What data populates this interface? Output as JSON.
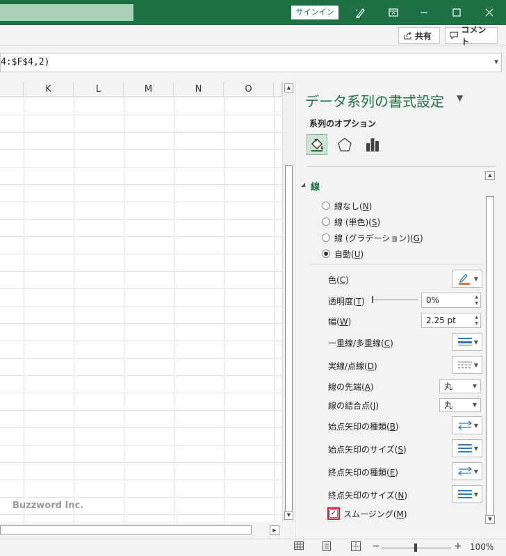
{
  "titlebar": {
    "signin_label": "サインイン",
    "icons": [
      "pen-icon",
      "ribbon-display-icon",
      "minimize-icon",
      "maximize-icon",
      "close-icon"
    ]
  },
  "ribbon": {
    "share_label": "共有",
    "comment_label": "コメント"
  },
  "formula": {
    "text": "4:$F$4,2)"
  },
  "grid": {
    "columns": [
      "K",
      "L",
      "M",
      "N",
      "O"
    ],
    "watermark": "Buzzword Inc."
  },
  "pane": {
    "title": "データ系列の書式設定",
    "series_dropdown": "系列のオプション",
    "section_title": "線",
    "line_options": [
      {
        "label": "線なし(",
        "key": "N",
        "suffix": ")",
        "selected": false
      },
      {
        "label": "線 (単色)(",
        "key": "S",
        "suffix": ")",
        "selected": false
      },
      {
        "label": "線 (グラデーション)(",
        "key": "G",
        "suffix": ")",
        "selected": false
      },
      {
        "label": "自動(",
        "key": "U",
        "suffix": ")",
        "selected": true
      }
    ],
    "props": {
      "color": {
        "label": "色(",
        "key": "C",
        "suffix": ")"
      },
      "transparency": {
        "label": "透明度(",
        "key": "T",
        "suffix": ")",
        "value": "0%"
      },
      "width": {
        "label": "幅(",
        "key": "W",
        "suffix": ")",
        "value": "2.25 pt"
      },
      "compound": {
        "label": "一重線/多重線(",
        "key": "C",
        "suffix": ")"
      },
      "dash": {
        "label": "実線/点線(",
        "key": "D",
        "suffix": ")"
      },
      "cap": {
        "label": "線の先端(",
        "key": "A",
        "suffix": ")",
        "value": "丸"
      },
      "join": {
        "label": "線の結合点(",
        "key": "J",
        "suffix": ")",
        "value": "丸"
      },
      "begin_arrow_type": {
        "label": "始点矢印の種類(",
        "key": "B",
        "suffix": ")"
      },
      "begin_arrow_size": {
        "label": "始点矢印のサイズ(",
        "key": "S",
        "suffix": ")"
      },
      "end_arrow_type": {
        "label": "終点矢印の種類(",
        "key": "E",
        "suffix": ")"
      },
      "end_arrow_size": {
        "label": "終点矢印のサイズ(",
        "key": "N",
        "suffix": ")"
      }
    },
    "smoothing": {
      "label": "スムージング(",
      "key": "M",
      "suffix": ")",
      "checked": true
    }
  },
  "statusbar": {
    "zoom": "100%",
    "zoom_minus": "−",
    "zoom_plus": "+"
  },
  "colors": {
    "brand": "#1e7145",
    "accent_orange": "#e07b2e",
    "accent_blue": "#2b78c2",
    "highlight_red": "#d0202e"
  }
}
